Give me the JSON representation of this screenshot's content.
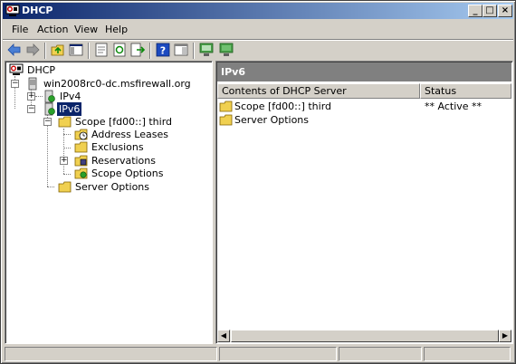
{
  "window": {
    "title": "DHCP"
  },
  "menu": {
    "items": [
      "File",
      "Action",
      "View",
      "Help"
    ]
  },
  "tree": {
    "root": "DHCP",
    "server": "win2008rc0-dc.msfirewall.org",
    "ipv4": "IPv4",
    "ipv6": "IPv6",
    "scope": "Scope [fd00::] third",
    "address_leases": "Address Leases",
    "exclusions": "Exclusions",
    "reservations": "Reservations",
    "scope_options": "Scope Options",
    "server_options": "Server Options"
  },
  "right_pane": {
    "header": "IPv6",
    "columns": [
      "Contents of DHCP Server",
      "Status"
    ],
    "rows": [
      {
        "name": "Scope [fd00::] third",
        "status": "** Active **"
      },
      {
        "name": "Server Options",
        "status": ""
      }
    ]
  },
  "icons": {
    "app": "dhcp-icon",
    "back": "back-arrow-icon",
    "forward": "forward-arrow-icon",
    "up": "up-folder-icon",
    "show_tree": "show-tree-icon",
    "properties": "properties-icon",
    "refresh": "refresh-icon",
    "export": "export-list-icon",
    "help": "help-icon",
    "console_tree": "console-tree-icon",
    "server1": "monitor-icon",
    "server2": "monitor-green-icon"
  },
  "colors": {
    "title_start": "#0a246a",
    "title_end": "#a6caf0",
    "pane_header": "#808080",
    "selection": "#0a246a"
  }
}
